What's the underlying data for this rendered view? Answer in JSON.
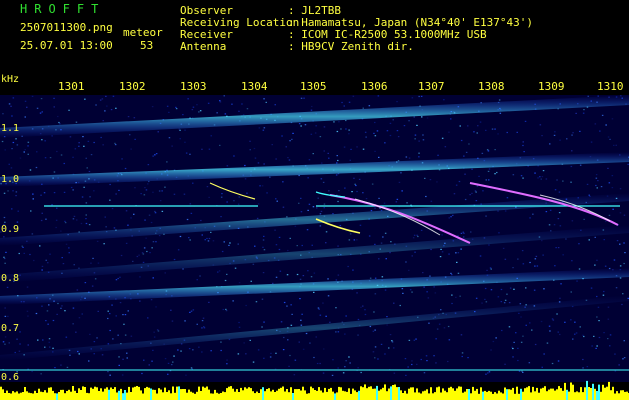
{
  "header": {
    "logo": "HROFFT",
    "filename": "2507011300.png",
    "mode": "meteor",
    "datetime": "25.07.01 13:00",
    "count": "53"
  },
  "info": [
    {
      "key": "Observer",
      "value": ": JL2TBB"
    },
    {
      "key": "Receiving Location",
      "value": ": Hamamatsu, Japan (N34°40' E137°43')"
    },
    {
      "key": "Receiver",
      "value": ": ICOM IC-R2500 53.1000MHz USB"
    },
    {
      "key": "Antenna",
      "value": ": HB9CV Zenith dir."
    }
  ],
  "axes": {
    "y_unit": "kHz",
    "y_ticks": [
      "1.1",
      "1.0",
      "0.9",
      "0.8",
      "0.7",
      "0.6"
    ],
    "x_ticks": [
      "1301",
      "1302",
      "1303",
      "1304",
      "1305",
      "1306",
      "1307",
      "1308",
      "1309",
      "1310"
    ]
  },
  "colors": {
    "background": "#000034",
    "text": "#ffff40",
    "logo": "#30e030",
    "trace_cyan": "#40ffff",
    "amplitude": "#ffff00"
  }
}
